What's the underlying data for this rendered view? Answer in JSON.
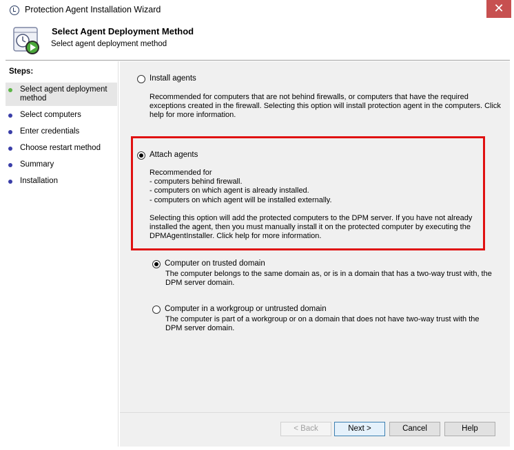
{
  "window": {
    "title": "Protection Agent Installation Wizard",
    "close_glyph": "✕",
    "close_color": "#c75050"
  },
  "header": {
    "title": "Select Agent Deployment Method",
    "subtitle": "Select agent deployment method",
    "icon": "clock-play-icon"
  },
  "steps": {
    "title": "Steps:",
    "items": [
      {
        "label": "Select agent deployment\nmethod",
        "active": true
      },
      {
        "label": "Select computers",
        "active": false
      },
      {
        "label": "Enter credentials",
        "active": false
      },
      {
        "label": "Choose restart method",
        "active": false
      },
      {
        "label": "Summary",
        "active": false
      },
      {
        "label": "Installation",
        "active": false
      }
    ],
    "active_dot_color": "#5db547",
    "dot_color": "#3a3ea8"
  },
  "options": {
    "install": {
      "label": "Install agents",
      "checked": false,
      "description": "Recommended for computers that are not behind firewalls, or computers that have the required\nexceptions created in the firewall. Selecting this option will install protection agent in the computers. Click\nhelp for more information."
    },
    "attach": {
      "label": "Attach agents",
      "checked": true,
      "description": "Recommended for\n- computers behind firewall.\n- computers on which agent is already installed.\n- computers on which agent will be installed externally.\n\nSelecting this option will add the protected computers to the DPM server. If you have not already\ninstalled the agent, then you must manually install it on the protected computer by executing the\nDPMAgentInstaller. Click help for more information."
    },
    "trusted_domain": {
      "label": "Computer on trusted domain",
      "checked": true,
      "description": "The computer belongs to the same domain as, or is in a domain that has a two-way trust with, the\nDPM server domain."
    },
    "workgroup": {
      "label": "Computer in a workgroup or untrusted domain",
      "checked": false,
      "description": "The computer is part of a workgroup or on a domain that does not have two-way trust with the\nDPM server domain."
    }
  },
  "highlight_color": "#e01010",
  "buttons": {
    "back": "< Back",
    "next": "Next >",
    "cancel": "Cancel",
    "help": "Help"
  }
}
